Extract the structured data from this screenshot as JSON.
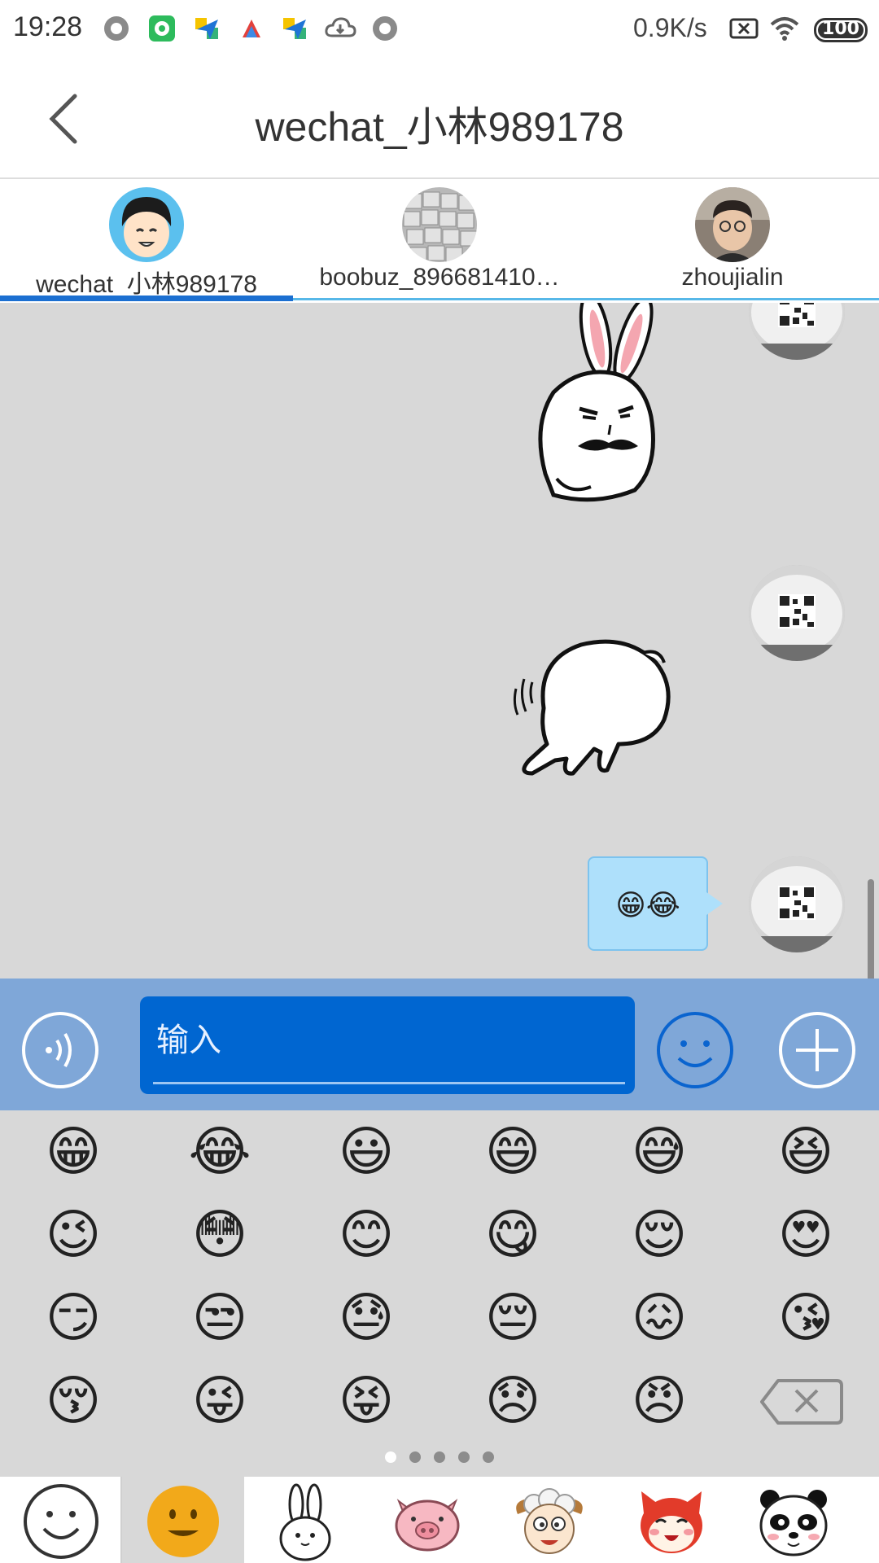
{
  "status_bar": {
    "time": "19:28",
    "net_speed": "0.9K/s",
    "battery": "100",
    "icons": [
      "record-icon",
      "wechat-app-icon",
      "plane-app-icon",
      "triangle-app-icon",
      "plane-app-icon",
      "cloud-icon",
      "record-icon",
      "sim-off-icon",
      "wifi-icon",
      "battery-icon"
    ]
  },
  "header": {
    "title": "wechat_小林989178"
  },
  "tabs": [
    {
      "label": "wechat_小林989178",
      "selected": true
    },
    {
      "label": "boobuz_896681410…",
      "selected": false
    },
    {
      "label": "zhoujialin",
      "selected": false
    }
  ],
  "chat": {
    "messages": [
      {
        "type": "sticker",
        "sticker": "rabbit-mustache-sticker"
      },
      {
        "type": "sticker",
        "sticker": "rabbit-running-sticker"
      },
      {
        "type": "text",
        "text": "😁😂"
      }
    ]
  },
  "input": {
    "placeholder": "输入"
  },
  "emoji_panel": {
    "rows": [
      [
        "😁",
        "😂",
        "😃",
        "😄",
        "😅",
        "😆"
      ],
      [
        "😉",
        "😳",
        "😊",
        "😋",
        "😌",
        "😍"
      ],
      [
        "😏",
        "😒",
        "😓",
        "😔",
        "😖",
        "😘"
      ],
      [
        "😚",
        "😜",
        "😝",
        "😞",
        "😠",
        "delete"
      ]
    ],
    "page_count": 5,
    "current_page": 1
  },
  "sticker_tabs": [
    "smiley-outline-icon",
    "smiley-yellow-icon",
    "rabbit-icon",
    "pig-icon",
    "sheep-icon",
    "fox-icon",
    "panda-icon"
  ],
  "colors": {
    "accent": "#1b6fd1",
    "input_bar": "#7fa7d8",
    "input_field": "#0066d1",
    "chat_bg": "#d8d8d8",
    "bubble": "#aee0fb"
  }
}
